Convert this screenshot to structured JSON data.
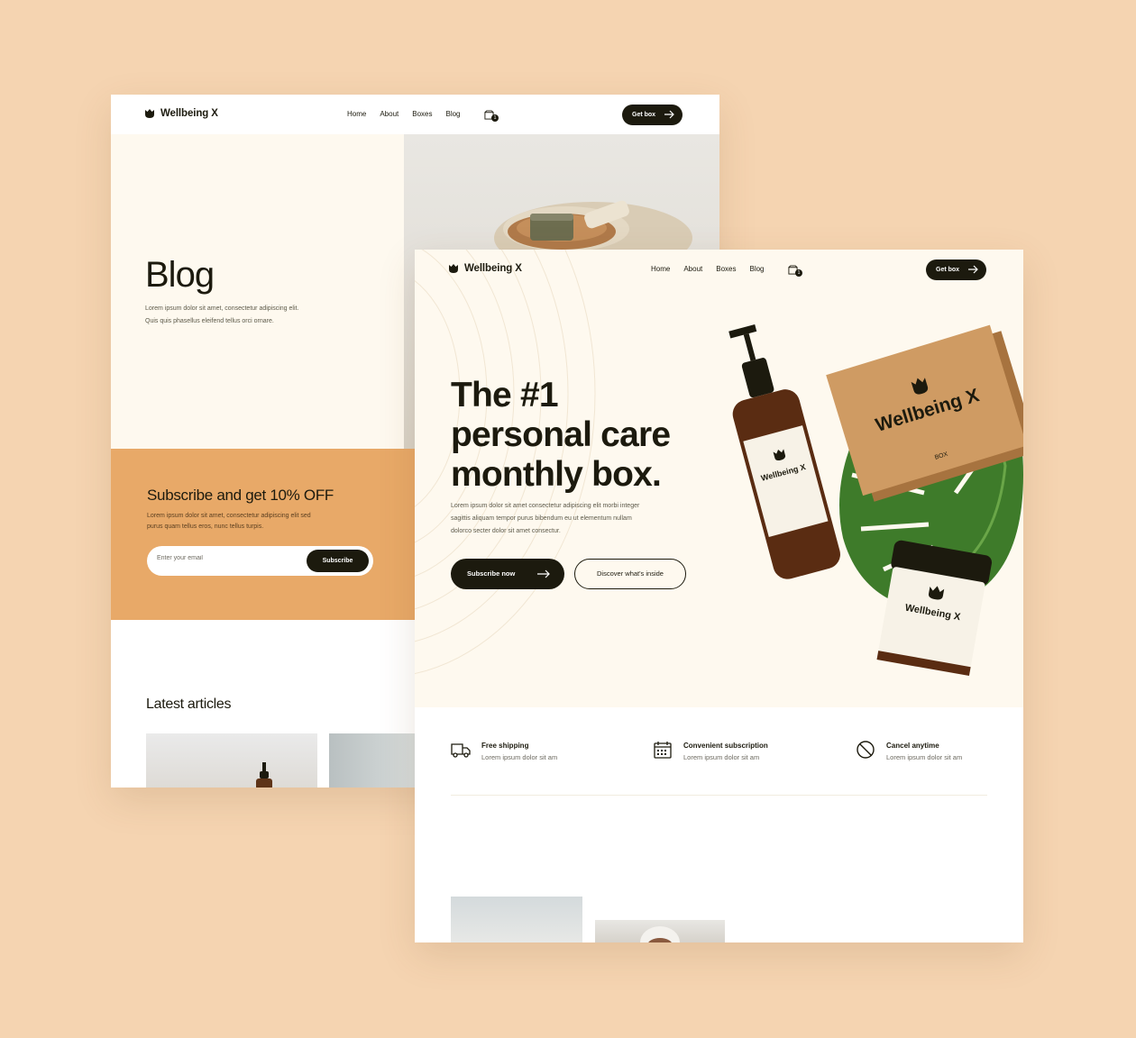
{
  "brand": {
    "name": "Wellbeing X"
  },
  "nav": {
    "links": [
      "Home",
      "About",
      "Boxes",
      "Blog"
    ],
    "cart_count": "1",
    "cta": "Get box"
  },
  "blog_page": {
    "title": "Blog",
    "description_line1": "Lorem ipsum dolor sit amet, consectetur adipiscing elit.",
    "description_line2": "Quis quis phasellus eleifend tellus orci ornare.",
    "subscribe": {
      "title": "Subscribe and get 10% OFF",
      "text_line1": "Lorem ipsum dolor sit amet, consectetur adipiscing elit sed",
      "text_line2": "purus quam tellus eros, nunc tellus turpis.",
      "email_placeholder": "Enter your email",
      "button": "Subscribe"
    },
    "latest_title": "Latest articles"
  },
  "home_page": {
    "hero_title_lines": [
      "The #1",
      "personal care",
      "monthly box."
    ],
    "hero_desc_line1": "Lorem ipsum dolor sit amet consectetur adipiscing elit morbi integer",
    "hero_desc_line2": "sagittis aliquam tempor purus bibendum eu ut elementum nullam",
    "hero_desc_line3": "dolorco secter dolor sit amet consectur.",
    "primary_button": "Subscribe now",
    "secondary_button": "Discover what's inside",
    "box_label": "Wellbeing X",
    "box_sub": "BOX",
    "bottle_label": "Wellbeing X",
    "jar_label": "Wellbeing X",
    "features": [
      {
        "title": "Free shipping",
        "subtitle": "Lorem ipsum dolor sit am",
        "icon": "truck-icon"
      },
      {
        "title": "Convenient subscription",
        "subtitle": "Lorem ipsum dolor sit am",
        "icon": "calendar-icon"
      },
      {
        "title": "Cancel anytime",
        "subtitle": "Lorem ipsum dolor sit am",
        "icon": "cancel-icon"
      }
    ]
  },
  "colors": {
    "background": "#f5d4b1",
    "cream": "#fef9ef",
    "accent": "#e8a968",
    "dark": "#1c1a0e"
  }
}
